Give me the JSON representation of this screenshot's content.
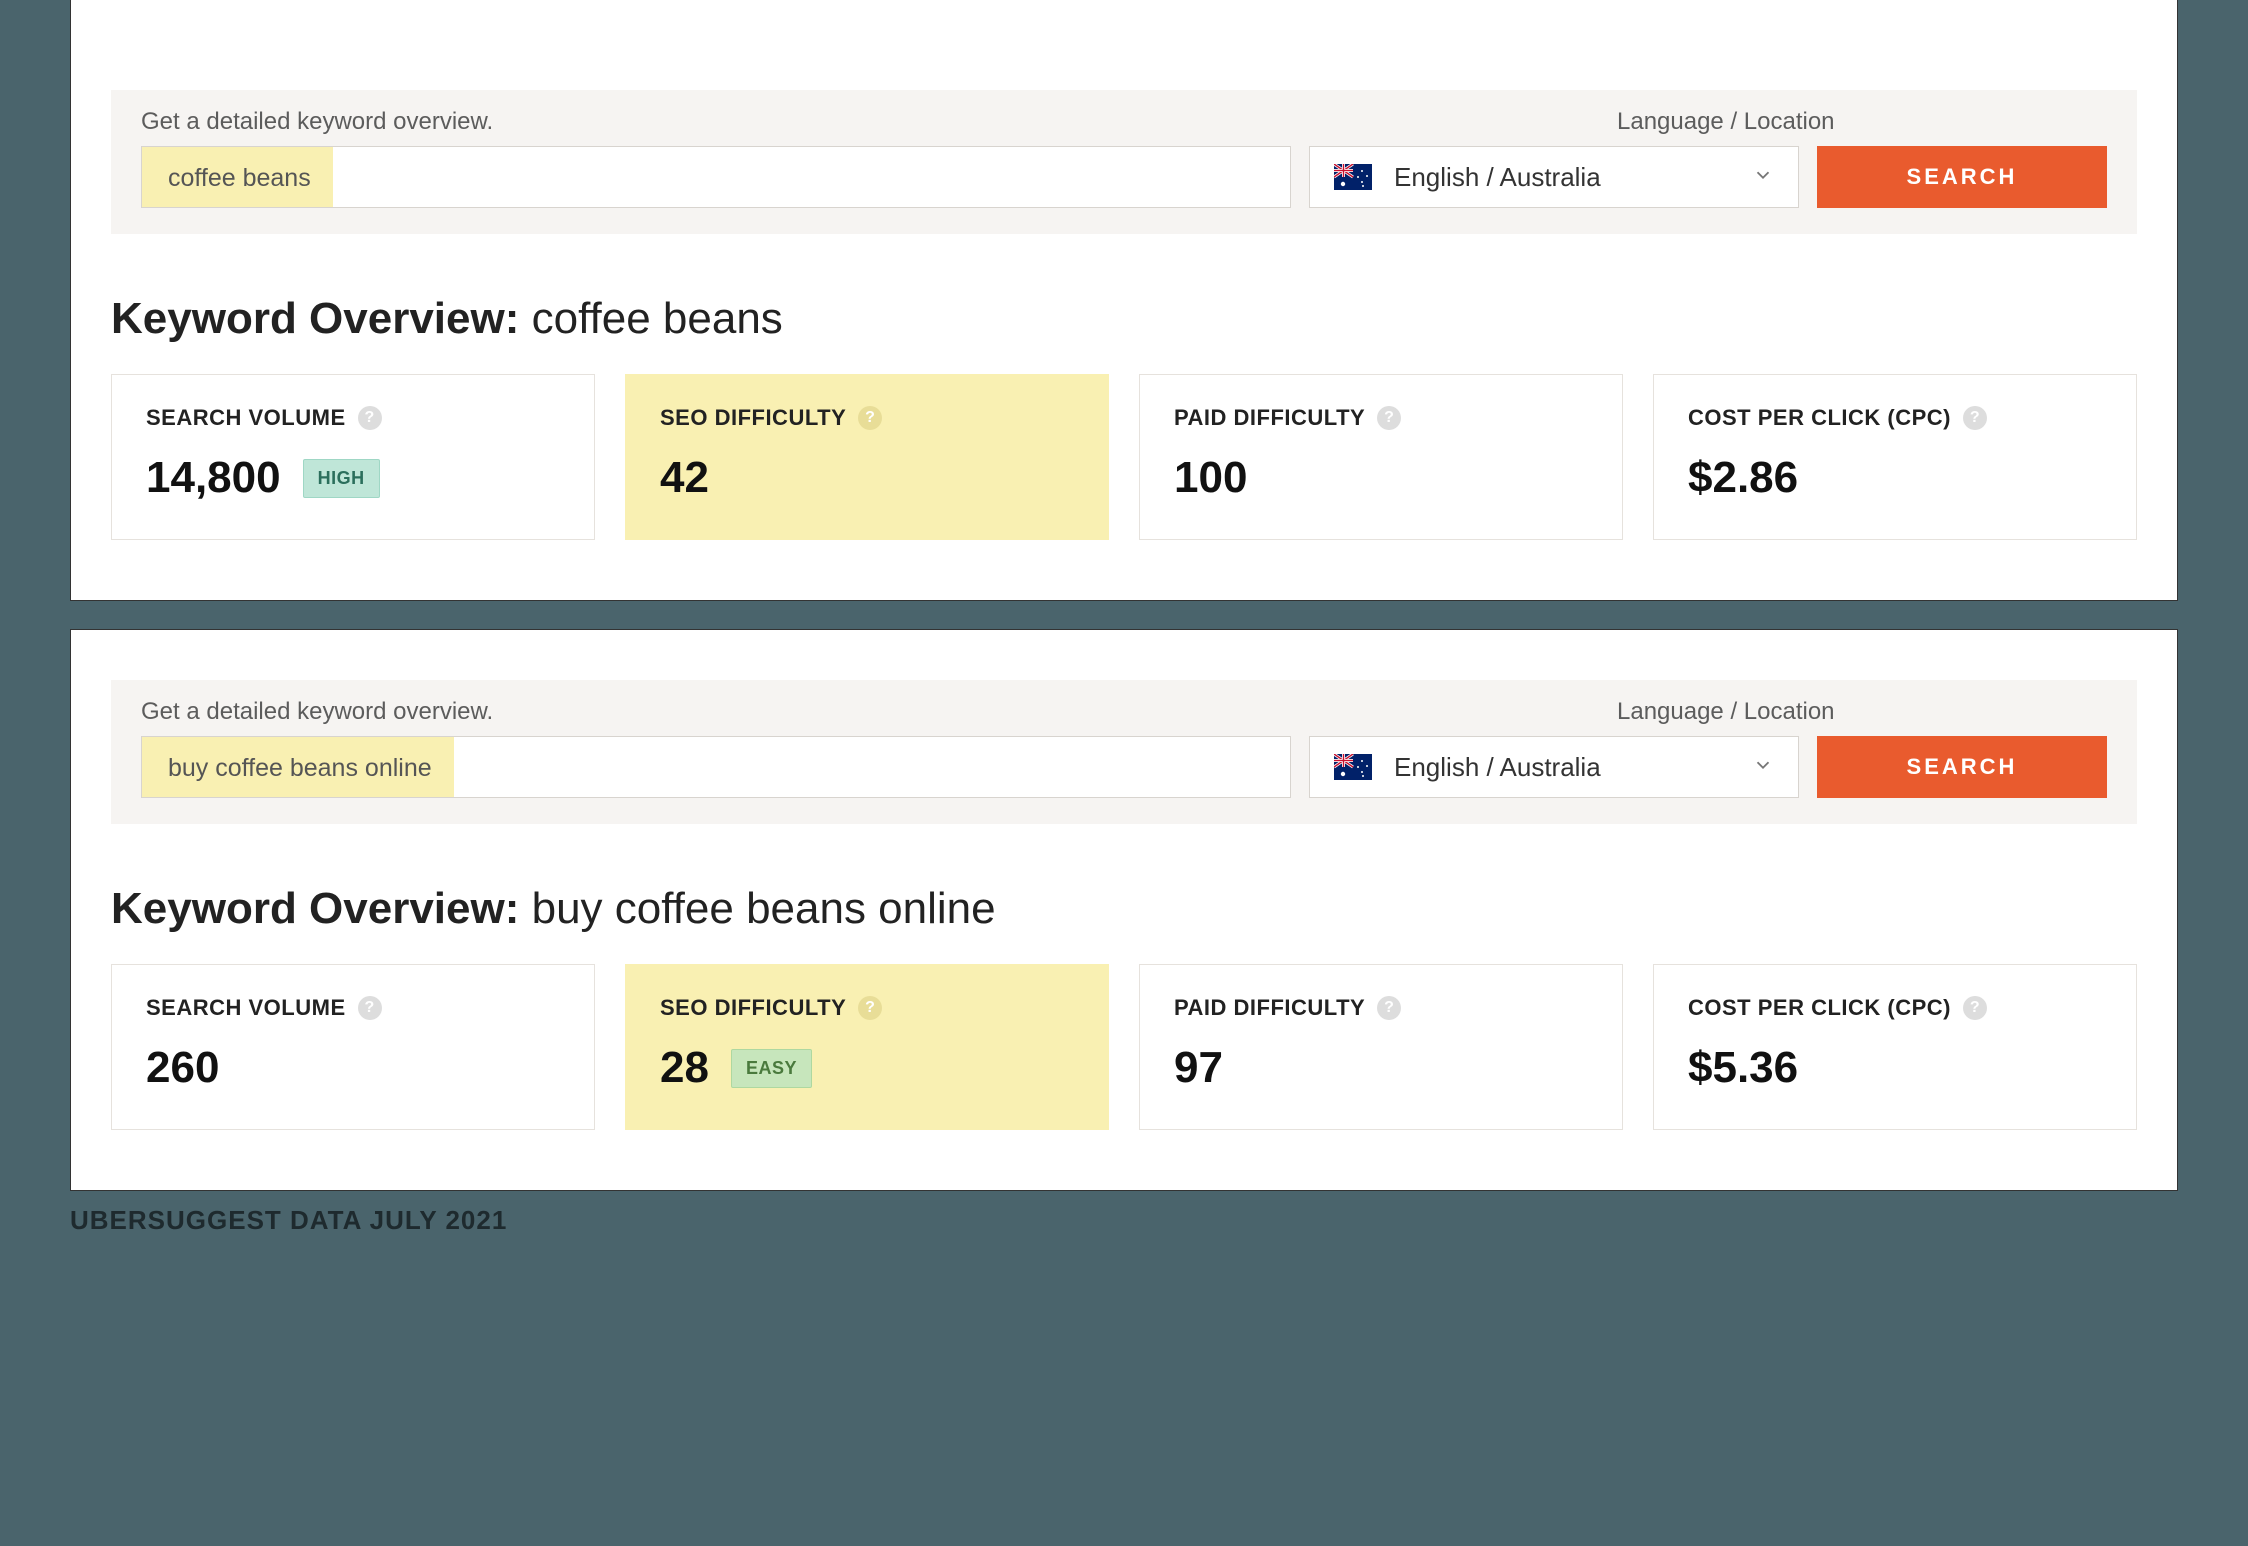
{
  "panels": [
    {
      "search": {
        "prompt": "Get a detailed keyword overview.",
        "keyword": "coffee beans",
        "locale_label": "Language / Location",
        "locale_value": "English / Australia",
        "button": "SEARCH"
      },
      "overview_prefix": "Keyword Overview:",
      "overview_keyword": "coffee beans",
      "metrics": {
        "search_volume": {
          "label": "SEARCH VOLUME",
          "value": "14,800",
          "badge": "HIGH",
          "badge_class": "high"
        },
        "seo_difficulty": {
          "label": "SEO DIFFICULTY",
          "value": "42",
          "badge": "",
          "highlight": true
        },
        "paid_difficulty": {
          "label": "PAID DIFFICULTY",
          "value": "100"
        },
        "cpc": {
          "label": "COST PER CLICK (CPC)",
          "value": "$2.86"
        }
      }
    },
    {
      "search": {
        "prompt": "Get a detailed keyword overview.",
        "keyword": "buy coffee beans online",
        "locale_label": "Language / Location",
        "locale_value": "English / Australia",
        "button": "SEARCH"
      },
      "overview_prefix": "Keyword Overview:",
      "overview_keyword": "buy coffee beans online",
      "metrics": {
        "search_volume": {
          "label": "SEARCH VOLUME",
          "value": "260",
          "badge": ""
        },
        "seo_difficulty": {
          "label": "SEO DIFFICULTY",
          "value": "28",
          "badge": "EASY",
          "badge_class": "easy",
          "highlight": true
        },
        "paid_difficulty": {
          "label": "PAID DIFFICULTY",
          "value": "97"
        },
        "cpc": {
          "label": "COST PER CLICK (CPC)",
          "value": "$5.36"
        }
      }
    }
  ],
  "caption": "UBERSUGGEST DATA JULY 2021"
}
